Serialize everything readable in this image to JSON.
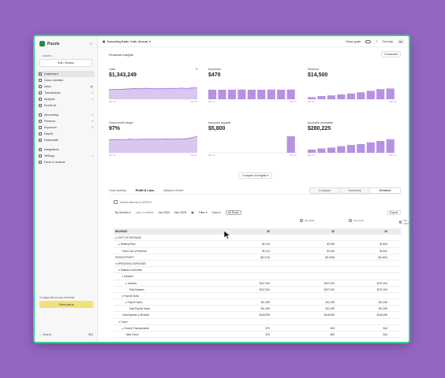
{
  "sidebar": {
    "app_name": "Puzzle",
    "company_label": "Acme's",
    "company_button": "Edit / Review",
    "nav": [
      {
        "label": "Dashboard",
        "active": true
      },
      {
        "label": "Close checklist"
      },
      {
        "label": "Inbox",
        "badge": "8"
      },
      {
        "label": "Transactions",
        "chev": "▾"
      },
      {
        "label": "Analysis",
        "chev": "▾"
      },
      {
        "label": "Puzzle AI"
      },
      {
        "gap": true
      },
      {
        "label": "Accounting",
        "chev": "▾"
      },
      {
        "label": "Revenue",
        "chev": "▾"
      },
      {
        "label": "Expenses",
        "chev": "▾"
      },
      {
        "label": "Payroll"
      },
      {
        "label": "Downloads"
      },
      {
        "gap": true
      },
      {
        "label": "Integrations"
      },
      {
        "label": "Settings",
        "chev": "▾"
      },
      {
        "label": "Perks & rewards"
      }
    ],
    "trial_text": "14 days left on your free trial",
    "trial_button": "View plans",
    "search_label": "Search",
    "search_shortcut": "⌘K"
  },
  "topbar": {
    "basis_label": "Accounting Basis: Cash, Accrual",
    "setup_label": "Setup guide",
    "help_label": "Get help",
    "avatar_text": "NH"
  },
  "insights": {
    "title": "Financial Insights",
    "connected_label": "Connected",
    "compare_button": "Compare 4 Insights ▾"
  },
  "cards": [
    {
      "title": "Cash",
      "value": "$1,343,249",
      "type": "area",
      "axis": [
        "Mar '23",
        "Mar '24"
      ],
      "data": [
        0.55,
        0.57,
        0.56,
        0.58,
        0.6,
        0.62,
        0.6,
        0.63,
        0.62,
        0.61,
        0.6,
        0.62,
        0.63,
        0.62,
        0.64,
        0.62,
        0.65,
        0.66
      ]
    },
    {
      "title": "Expenses",
      "value": "$470",
      "type": "bar",
      "axis": [
        "Mar '23",
        "Mar '24"
      ],
      "data": [
        0.55,
        0.55,
        0.55,
        0.56,
        0.55,
        0.55,
        0.56,
        0.55,
        0.56
      ]
    },
    {
      "title": "Revenue",
      "value": "$14,500",
      "type": "bar",
      "axis": [
        "Mar '23",
        "Mar '24"
      ],
      "data": [
        0.12,
        0.18,
        0.22,
        0.28,
        0.33,
        0.4,
        0.48,
        0.58,
        0.62
      ]
    },
    {
      "title": "Gross profit margin",
      "value": "97%",
      "type": "area",
      "axis": [
        "Mar '23",
        "Mar '24"
      ],
      "data": [
        0.75,
        0.76,
        0.77,
        0.77,
        0.78,
        0.77,
        0.78,
        0.78,
        0.79,
        0.78,
        0.79,
        0.8,
        0.79,
        0.8,
        0.8,
        0.81,
        0.88,
        0.95
      ]
    },
    {
      "title": "Accounts payable",
      "value": "$5,800",
      "type": "bar",
      "axis": [
        "Mar '23",
        "Mar '24"
      ],
      "data": [
        0,
        0,
        0,
        0,
        0,
        0,
        0,
        0,
        0.95
      ]
    },
    {
      "title": "Accounts receivable",
      "value": "$280,225",
      "type": "bar",
      "axis": [
        "Mar '23",
        "Mar '24"
      ],
      "data": [
        0.18,
        0.25,
        0.3,
        0.38,
        0.45,
        0.5,
        0.6,
        0.68,
        0.78
      ]
    }
  ],
  "report": {
    "tabs": [
      {
        "label": "Cash Activity"
      },
      {
        "label": "Profit & Loss",
        "active": true
      },
      {
        "label": "Balance Sheet"
      }
    ],
    "view_modes": [
      {
        "label": "Compact"
      },
      {
        "label": "Summary"
      },
      {
        "label": "Detailed",
        "on": true
      }
    ],
    "accrual_text": "Include data as of 12/31/20",
    "filters": {
      "period": "By Months ▾",
      "range_label": "Last 3 months",
      "from": "Jan 2025",
      "to": "Mar 2025",
      "filter": "Filter ▾",
      "basis": "Cash ▾",
      "all_rows": "All Rows",
      "export": "Export"
    },
    "columns": [
      "Jan 2025",
      "Feb 2025",
      "Mar 2025"
    ],
    "rows": [
      {
        "label": "REVENUE",
        "indent": 0,
        "hdr": true,
        "v": [
          "$0",
          "$0",
          "$0"
        ]
      },
      {
        "label": "▸ COST OF REVENUE",
        "indent": 0,
        "v": [
          "",
          "",
          ""
        ]
      },
      {
        "label": "▸ Hosting Fees",
        "indent": 2,
        "v": [
          "$2,124",
          "$1,945",
          "$1,842"
        ]
      },
      {
        "label": "Total Cost of Revenue",
        "indent": 4,
        "v": [
          "$2,124",
          "$1,945",
          "$1,842"
        ]
      },
      {
        "label": "GROSS PROFIT",
        "indent": 0,
        "v": [
          "($2,124)",
          "($1,945)",
          "($1,842)"
        ]
      },
      {
        "label": "▾ OPERATING EXPENSES",
        "indent": 0,
        "v": [
          "",
          "",
          ""
        ]
      },
      {
        "label": "▾ Salaries & Benefits",
        "indent": 2,
        "v": [
          "",
          "",
          ""
        ]
      },
      {
        "label": "▾ Salaries",
        "indent": 4,
        "v": [
          "",
          "",
          ""
        ]
      },
      {
        "label": "▸ Salaries",
        "indent": 6,
        "v": [
          "$137,000",
          "$137,000",
          "$137,000"
        ]
      },
      {
        "label": "Total Salaries",
        "indent": 8,
        "v": [
          "$137,000",
          "$137,000",
          "$137,000"
        ]
      },
      {
        "label": "▾ Payroll Taxes",
        "indent": 4,
        "v": [
          "",
          "",
          ""
        ]
      },
      {
        "label": "▸ Payroll Taxes",
        "indent": 6,
        "v": [
          "$11,395",
          "$11,395",
          "$11,395"
        ]
      },
      {
        "label": "Total Payroll Taxes",
        "indent": 8,
        "v": [
          "$11,395",
          "$11,395",
          "$11,395"
        ]
      },
      {
        "label": "Total Salaries & Benefits",
        "indent": 4,
        "v": [
          "$148,395",
          "$148,395",
          "$148,395"
        ]
      },
      {
        "label": "▾ Travel",
        "indent": 2,
        "v": [
          "",
          "",
          ""
        ]
      },
      {
        "label": "▸ Ground Transportation",
        "indent": 4,
        "v": [
          "$75",
          "$25",
          "$44"
        ]
      },
      {
        "label": "Total Travel",
        "indent": 6,
        "v": [
          "$75",
          "$25",
          "$44"
        ]
      }
    ]
  },
  "colors": {
    "accent": "#9a6fd0",
    "accent_light": "#d9c7ef",
    "window_border": "#3fcf8e",
    "background": "#9466c4"
  }
}
